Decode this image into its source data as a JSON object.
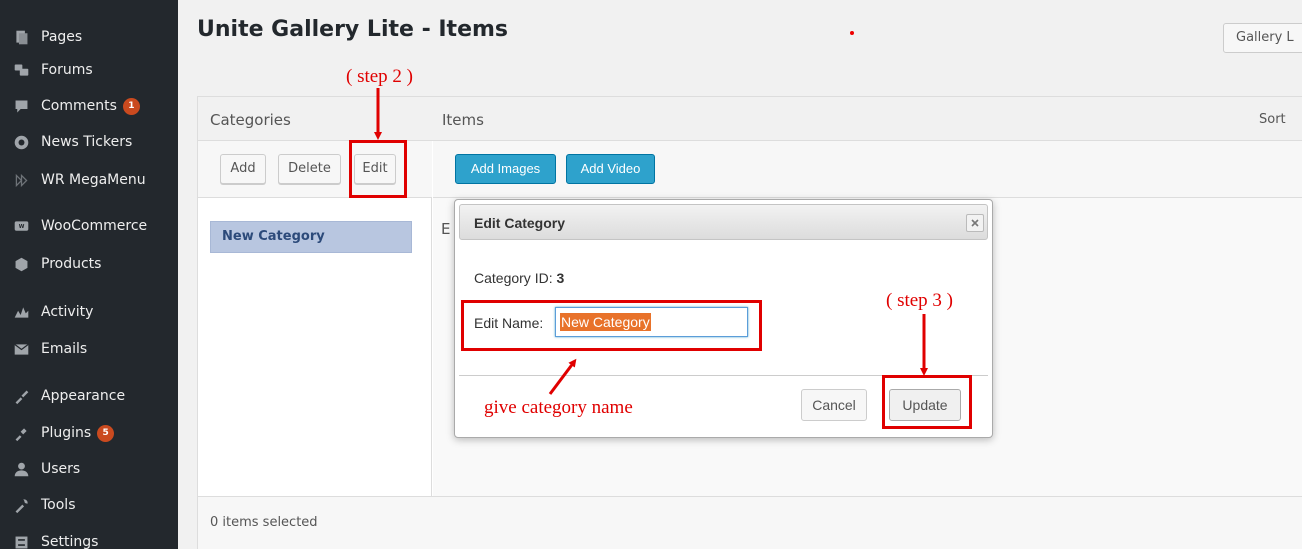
{
  "sidebar": {
    "items": [
      {
        "label": "Pages",
        "icon": "pages-icon",
        "badge": null
      },
      {
        "label": "Forums",
        "icon": "forums-icon",
        "badge": null
      },
      {
        "label": "Comments",
        "icon": "comments-icon",
        "badge": "1"
      },
      {
        "label": "News Tickers",
        "icon": "news-tickers-icon",
        "badge": null
      },
      {
        "label": "WR MegaMenu",
        "icon": "megamenu-icon",
        "badge": null
      },
      {
        "label": "WooCommerce",
        "icon": "woocommerce-icon",
        "badge": null
      },
      {
        "label": "Products",
        "icon": "products-icon",
        "badge": null
      },
      {
        "label": "Activity",
        "icon": "activity-icon",
        "badge": null
      },
      {
        "label": "Emails",
        "icon": "emails-icon",
        "badge": null
      },
      {
        "label": "Appearance",
        "icon": "appearance-icon",
        "badge": null
      },
      {
        "label": "Plugins",
        "icon": "plugins-icon",
        "badge": "5"
      },
      {
        "label": "Users",
        "icon": "users-icon",
        "badge": null
      },
      {
        "label": "Tools",
        "icon": "tools-icon",
        "badge": null
      },
      {
        "label": "Settings",
        "icon": "settings-icon",
        "badge": null
      }
    ]
  },
  "header": {
    "title": "Unite Gallery Lite - Items",
    "gallery_button": "Gallery L"
  },
  "panel": {
    "categories_title": "Categories",
    "items_title": "Items",
    "sort_label": "Sort",
    "category_buttons": {
      "add": "Add",
      "delete": "Delete",
      "edit": "Edit"
    },
    "item_buttons": {
      "add_images": "Add Images",
      "add_video": "Add Video"
    },
    "categories": [
      "New Category"
    ],
    "items_placeholder_letter": "E",
    "footer": "0 items selected"
  },
  "dialog": {
    "title": "Edit Category",
    "category_id_label": "Category ID:",
    "category_id_value": "3",
    "edit_name_label": "Edit Name:",
    "edit_name_value": "New Category",
    "cancel": "Cancel",
    "update": "Update"
  },
  "annotations": {
    "step2": "( step 2 )",
    "step3": "( step 3 )",
    "give_name": "give category name"
  },
  "colors": {
    "sidebar_bg": "#23282d",
    "accent_blue": "#2ea2cc",
    "annotation_red": "#e00000",
    "badge": "#ca4a1f",
    "selection": "#e8722a"
  }
}
